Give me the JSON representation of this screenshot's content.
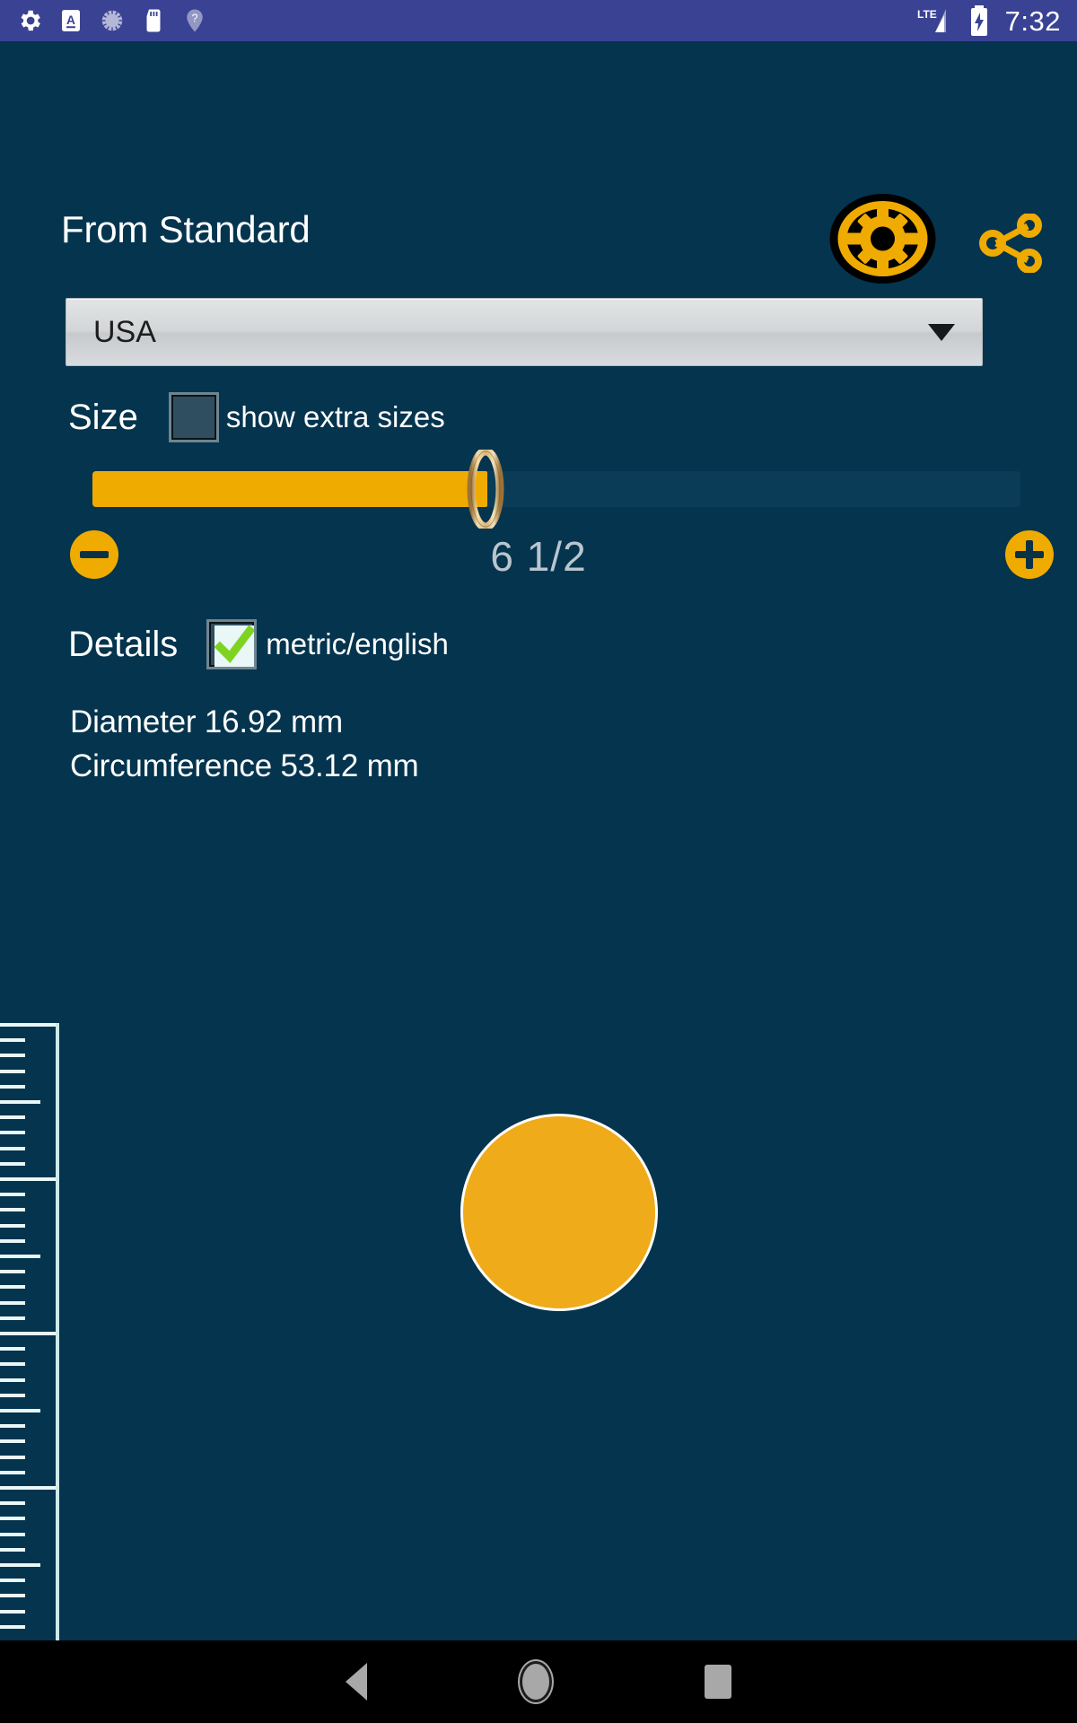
{
  "statusbar": {
    "icons": [
      {
        "name": "settings-gear-icon"
      },
      {
        "name": "letter-a-icon"
      },
      {
        "name": "loading-spinner-icon"
      },
      {
        "name": "sd-card-icon"
      },
      {
        "name": "unknown-location-icon"
      }
    ],
    "network_label": "LTE",
    "signal_icon": "signal-bars-icon",
    "battery_icon": "battery-charging-icon",
    "time": "7:32"
  },
  "header": {
    "title": "From Standard",
    "settings_icon": "gear-icon",
    "share_icon": "share-icon"
  },
  "standard_select": {
    "value": "USA",
    "caret_icon": "chevron-down-icon"
  },
  "size_section": {
    "label": "Size",
    "extra_sizes_label": "show extra sizes",
    "extra_sizes_checked": false,
    "slider": {
      "value": "6 1/2",
      "fill_percent": 42,
      "thumb_icon": "ring-thumb-icon"
    },
    "decrement_icon": "minus-circle-icon",
    "increment_icon": "plus-circle-icon"
  },
  "details_section": {
    "label": "Details",
    "metric_english_label": "metric/english",
    "metric_english_checked": true,
    "lines": [
      "Diameter 16.92 mm",
      "Circumference 53.12 mm"
    ]
  },
  "ruler": {
    "name": "measurement-ruler"
  },
  "ring_preview": {
    "name": "ring-size-circle"
  },
  "navbar": {
    "back_icon": "back-triangle-icon",
    "home_icon": "home-circle-icon",
    "recent_icon": "recents-square-icon"
  },
  "colors": {
    "background": "#04344e",
    "statusbar": "#3a4294",
    "accent": "#f0ab00",
    "check": "#7ed321",
    "text": "#ffffff"
  }
}
